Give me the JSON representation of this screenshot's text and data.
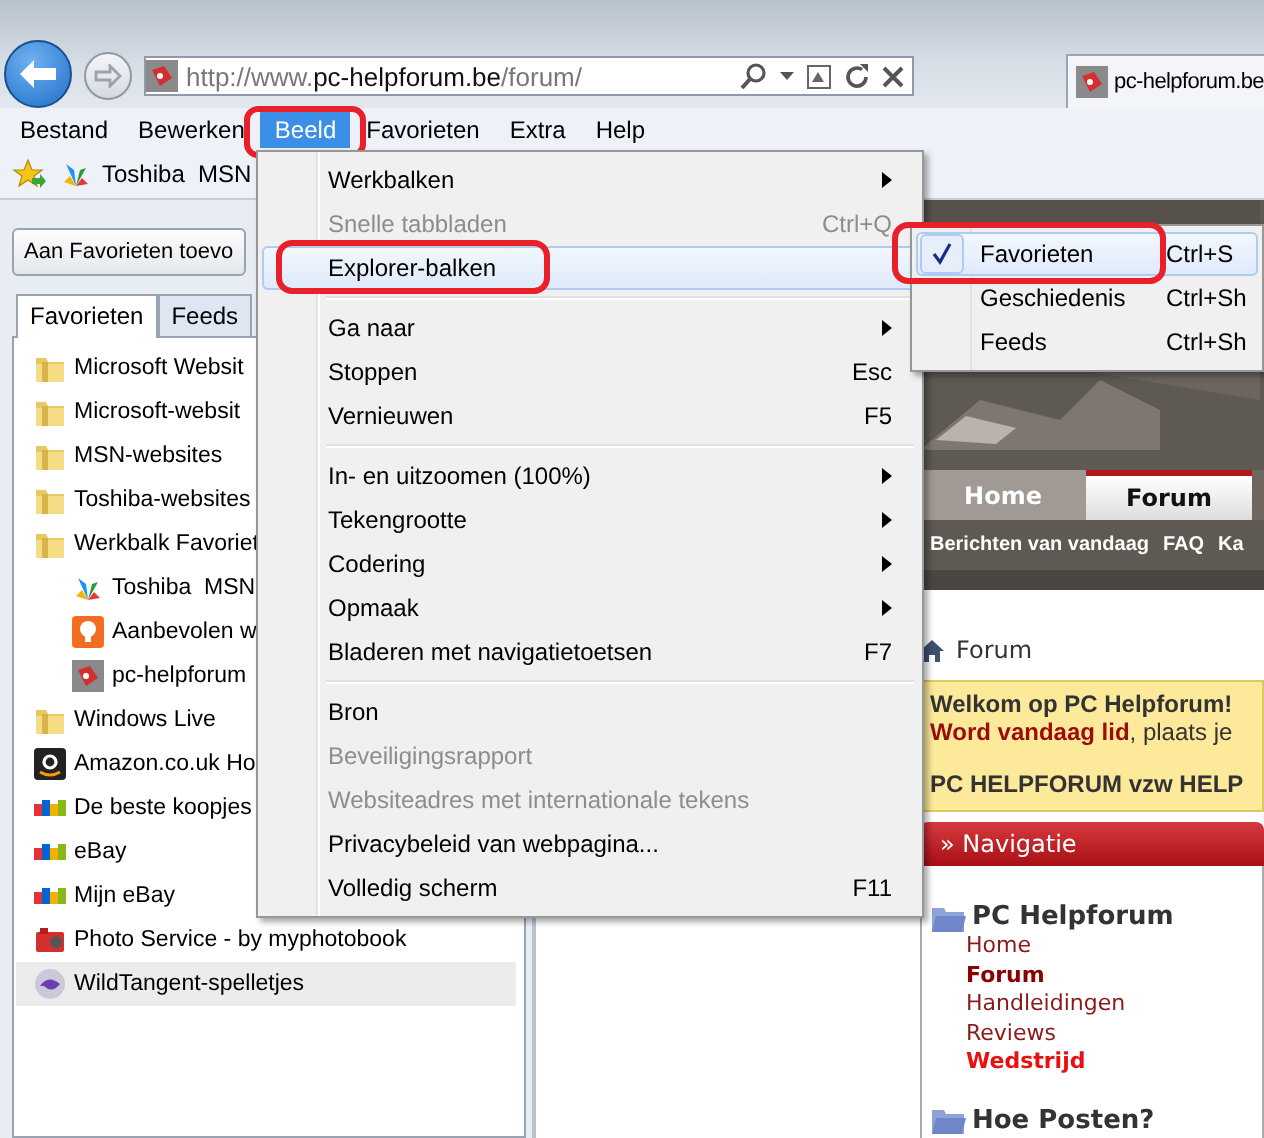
{
  "browser": {
    "address": {
      "scheme": "http://www.",
      "domain": "pc-helpforum.be",
      "path": "/forum/"
    },
    "tab": {
      "title": "pc-helpforum.be"
    }
  },
  "menubar": [
    {
      "label": "Bestand",
      "selected": false,
      "circled": false
    },
    {
      "label": "Bewerken",
      "selected": false,
      "circled": false
    },
    {
      "label": "Beeld",
      "selected": true,
      "circled": true
    },
    {
      "label": "Favorieten",
      "selected": false,
      "circled": false
    },
    {
      "label": "Extra",
      "selected": false,
      "circled": false
    },
    {
      "label": "Help",
      "selected": false,
      "circled": false
    }
  ],
  "favorites_bar": [
    {
      "label": "Toshiba  MSN"
    }
  ],
  "favorites_panel": {
    "add_button": "Aan Favorieten toevo",
    "tabs": [
      {
        "label": "Favorieten",
        "selected": true
      },
      {
        "label": "Feeds",
        "selected": false
      }
    ],
    "items": [
      {
        "kind": "folder",
        "label": "Microsoft Websit",
        "selected": false
      },
      {
        "kind": "folder",
        "label": "Microsoft-websit",
        "selected": false
      },
      {
        "kind": "folder",
        "label": "MSN-websites",
        "selected": false
      },
      {
        "kind": "folder",
        "label": "Toshiba-websites",
        "selected": false
      },
      {
        "kind": "folder",
        "label": "Werkbalk Favoriet",
        "selected": false,
        "children": [
          {
            "kind": "msn",
            "label": "Toshiba  MSN",
            "selected": false
          },
          {
            "kind": "bulb",
            "label": "Aanbevolen w",
            "selected": false
          },
          {
            "kind": "forum",
            "label": "pc-helpforum",
            "selected": false
          }
        ]
      },
      {
        "kind": "folder",
        "label": "Windows Live",
        "selected": false
      },
      {
        "kind": "amazon",
        "label": "Amazon.co.uk Ho",
        "selected": false
      },
      {
        "kind": "ebay",
        "label": "De beste koopjes",
        "selected": false
      },
      {
        "kind": "ebay",
        "label": "eBay",
        "selected": false
      },
      {
        "kind": "ebay",
        "label": "Mijn eBay",
        "selected": false
      },
      {
        "kind": "camera",
        "label": "Photo Service - by myphotobook",
        "selected": false
      },
      {
        "kind": "games",
        "label": "WildTangent-spelletjes",
        "selected": true
      }
    ]
  },
  "view_menu": [
    {
      "kind": "item",
      "label": "Werkbalken",
      "submenu": true,
      "disabled": false,
      "highlighted": false,
      "circled": false
    },
    {
      "kind": "item",
      "label": "Snelle tabbladen",
      "shortcut": "Ctrl+Q",
      "submenu": false,
      "disabled": true,
      "highlighted": false,
      "circled": false
    },
    {
      "kind": "item",
      "label": "Explorer-balken",
      "submenu": false,
      "disabled": false,
      "highlighted": true,
      "circled": true
    },
    {
      "kind": "separator"
    },
    {
      "kind": "item",
      "label": "Ga naar",
      "submenu": true,
      "disabled": false,
      "highlighted": false,
      "circled": false
    },
    {
      "kind": "item",
      "label": "Stoppen",
      "shortcut": "Esc",
      "submenu": false,
      "disabled": false,
      "highlighted": false,
      "circled": false
    },
    {
      "kind": "item",
      "label": "Vernieuwen",
      "shortcut": "F5",
      "submenu": false,
      "disabled": false,
      "highlighted": false,
      "circled": false
    },
    {
      "kind": "separator"
    },
    {
      "kind": "item",
      "label": "In- en uitzoomen (100%)",
      "submenu": true,
      "disabled": false,
      "highlighted": false,
      "circled": false
    },
    {
      "kind": "item",
      "label": "Tekengrootte",
      "submenu": true,
      "disabled": false,
      "highlighted": false,
      "circled": false
    },
    {
      "kind": "item",
      "label": "Codering",
      "submenu": true,
      "disabled": false,
      "highlighted": false,
      "circled": false
    },
    {
      "kind": "item",
      "label": "Opmaak",
      "submenu": true,
      "disabled": false,
      "highlighted": false,
      "circled": false
    },
    {
      "kind": "item",
      "label": "Bladeren met navigatietoetsen",
      "shortcut": "F7",
      "submenu": false,
      "disabled": false,
      "highlighted": false,
      "circled": false
    },
    {
      "kind": "separator"
    },
    {
      "kind": "item",
      "label": "Bron",
      "submenu": false,
      "disabled": false,
      "highlighted": false,
      "circled": false
    },
    {
      "kind": "item",
      "label": "Beveiligingsrapport",
      "submenu": false,
      "disabled": true,
      "highlighted": false,
      "circled": false
    },
    {
      "kind": "item",
      "label": "Websiteadres met internationale tekens",
      "submenu": false,
      "disabled": true,
      "highlighted": false,
      "circled": false
    },
    {
      "kind": "item",
      "label": "Privacybeleid van webpagina...",
      "submenu": false,
      "disabled": false,
      "highlighted": false,
      "circled": false
    },
    {
      "kind": "item",
      "label": "Volledig scherm",
      "shortcut": "F11",
      "submenu": false,
      "disabled": false,
      "highlighted": false,
      "circled": false
    }
  ],
  "explorer_bars_menu": [
    {
      "label": "Favorieten",
      "shortcut": "Ctrl+S",
      "checked": true,
      "highlighted": true,
      "circled": true
    },
    {
      "label": "Geschiedenis",
      "shortcut": "Ctrl+Sh",
      "checked": false,
      "highlighted": false,
      "circled": false
    },
    {
      "label": "Feeds",
      "shortcut": "Ctrl+Sh",
      "checked": false,
      "highlighted": false,
      "circled": false
    }
  ],
  "web_page": {
    "nav_tabs": [
      {
        "label": "Home",
        "selected": false
      },
      {
        "label": "Forum",
        "selected": true
      }
    ],
    "subnav": [
      "Berichten van vandaag",
      "FAQ",
      "Ka"
    ],
    "breadcrumb": "Forum",
    "notice": {
      "title": "Welkom op PC Helpforum!",
      "text": "**Word vandaag lid**, plaats je",
      "footer": "PC HELPFORUM vzw HELP"
    },
    "navigation": {
      "header": "» Navigatie",
      "sections": [
        {
          "title": "PC Helpforum",
          "links": [
            {
              "label": "Home",
              "kind": "normal"
            },
            {
              "label": "Forum",
              "kind": "current"
            },
            {
              "label": "Handleidingen",
              "kind": "normal"
            },
            {
              "label": "Reviews",
              "kind": "normal"
            },
            {
              "label": "Wedstrijd",
              "kind": "featured"
            }
          ]
        },
        {
          "title": "Hoe Posten?"
        }
      ]
    }
  }
}
